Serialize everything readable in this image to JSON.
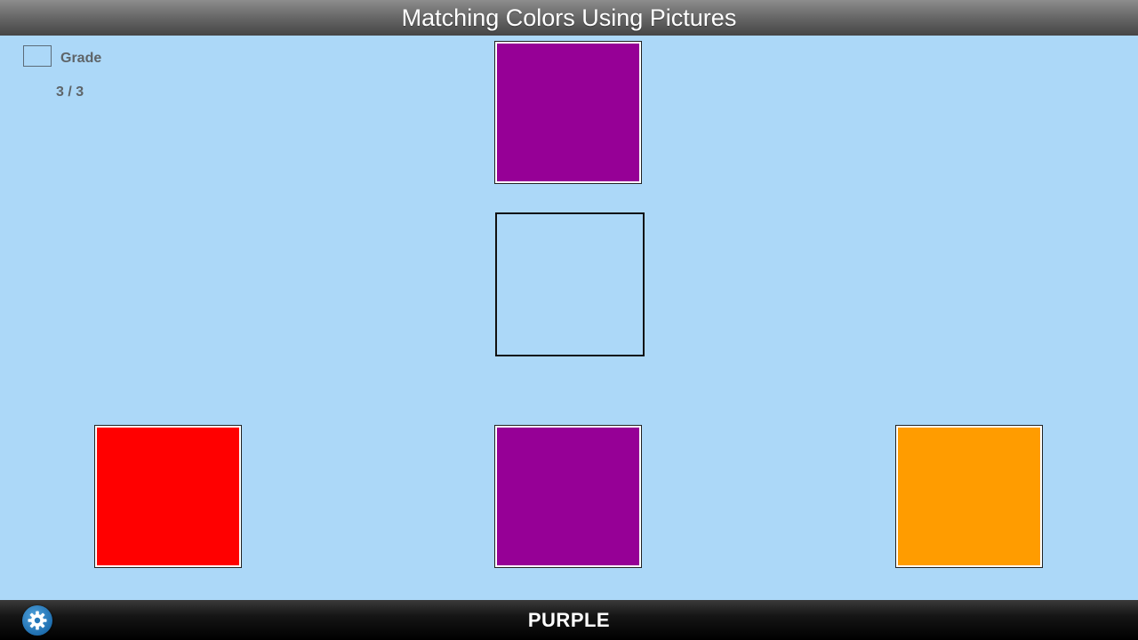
{
  "header": {
    "title": "Matching Colors Using Pictures"
  },
  "grade": {
    "label": "Grade",
    "score": "3 / 3"
  },
  "target_card": {
    "color_name": "purple",
    "color": "#960096"
  },
  "choices": [
    {
      "color_name": "red",
      "color": "#ff0000"
    },
    {
      "color_name": "purple",
      "color": "#960096"
    },
    {
      "color_name": "orange",
      "color": "#ff9c00"
    }
  ],
  "footer": {
    "prompt": "PURPLE",
    "settings_icon": "gear-icon"
  },
  "colors": {
    "background": "#acd8f8",
    "title_bar": "#5a5a5a",
    "bottom_bar": "#111111",
    "settings_button": "#2477b8"
  }
}
